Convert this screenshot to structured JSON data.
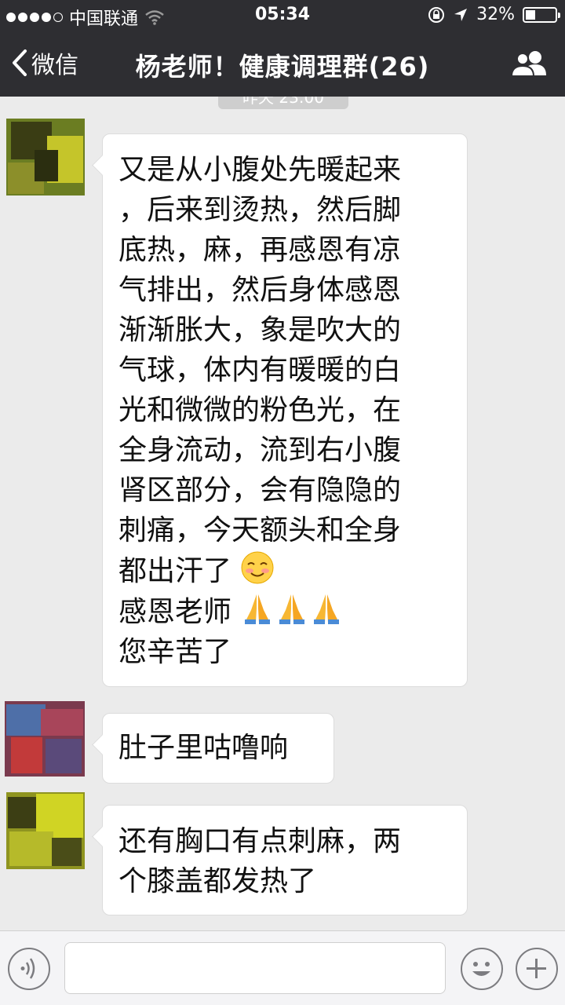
{
  "status_bar": {
    "carrier": "中国联通",
    "time": "05:34",
    "battery": "32%",
    "battery_level": 0.32
  },
  "nav": {
    "back_label": "微信",
    "title": "杨老师！健康调理群(26)"
  },
  "chat": {
    "timestamp": "昨天 23:00",
    "messages": [
      {
        "lines": [
          "又是从小腹处先暖起来",
          "，后来到烫热，然后脚",
          "底热，麻，再感恩有凉",
          "气排出，然后身体感恩",
          "渐渐胀大，象是吹大的",
          "气球，体内有暖暖的白",
          "光和微微的粉色光，在",
          "全身流动，流到右小腹",
          "肾区部分，会有隐隐的",
          "刺痛，今天额头和全身",
          "都出汗了",
          "感恩老师",
          "您辛苦了"
        ]
      },
      {
        "text": "肚子里咕噜响"
      },
      {
        "lines": [
          "还有胸口有点刺麻，两",
          "个膝盖都发热了"
        ]
      }
    ]
  },
  "icons": {
    "back": "chevron-left-icon",
    "members": "group-icon",
    "voice": "voice-icon",
    "emoji": "smiley-icon",
    "more": "plus-icon"
  },
  "colors": {
    "nav_bg": "#2e2e32",
    "chat_bg": "#ebebeb",
    "bubble_bg": "#ffffff",
    "input_bg": "#f4f4f6"
  }
}
